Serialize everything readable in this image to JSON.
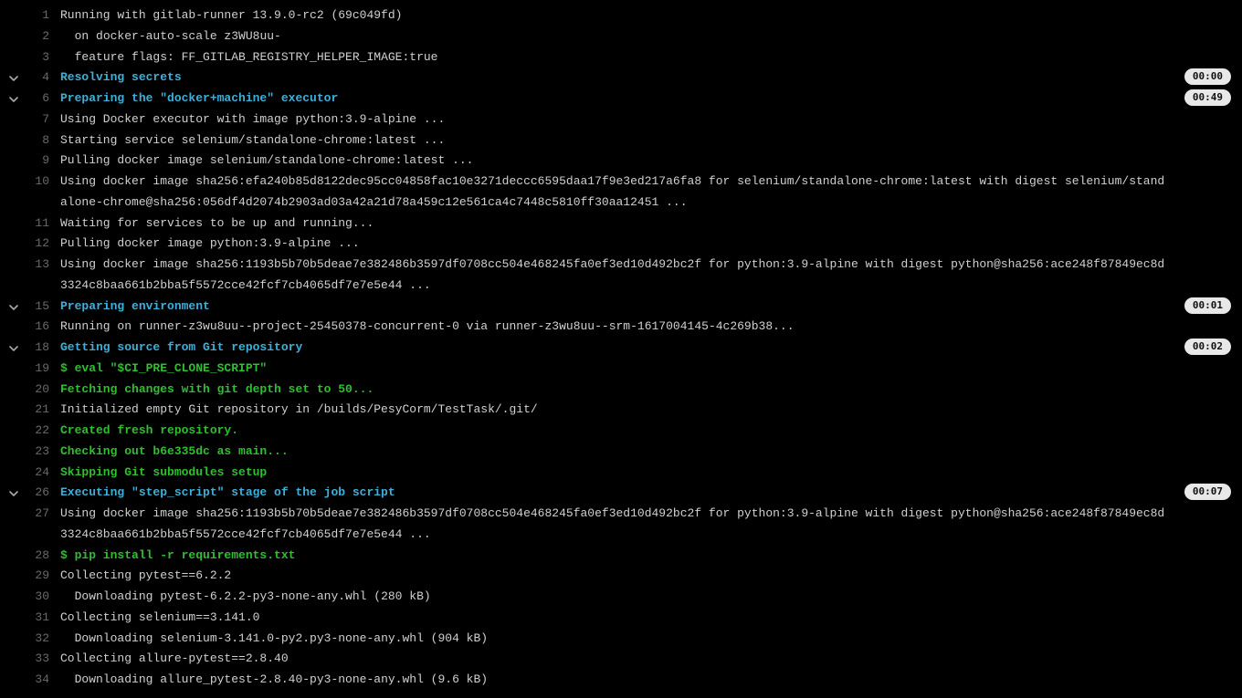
{
  "lines": [
    {
      "n": 1,
      "cls": "c-default",
      "collapsible": false,
      "badge": null,
      "text": "Running with gitlab-runner 13.9.0-rc2 (69c049fd)"
    },
    {
      "n": 2,
      "cls": "c-default",
      "collapsible": false,
      "badge": null,
      "text": "  on docker-auto-scale z3WU8uu-"
    },
    {
      "n": 3,
      "cls": "c-default",
      "collapsible": false,
      "badge": null,
      "text": "  feature flags: FF_GITLAB_REGISTRY_HELPER_IMAGE:true"
    },
    {
      "n": 4,
      "cls": "c-section",
      "collapsible": true,
      "badge": "00:00",
      "text": "Resolving secrets"
    },
    {
      "n": 6,
      "cls": "c-section",
      "collapsible": true,
      "badge": "00:49",
      "text": "Preparing the \"docker+machine\" executor"
    },
    {
      "n": 7,
      "cls": "c-default",
      "collapsible": false,
      "badge": null,
      "text": "Using Docker executor with image python:3.9-alpine ..."
    },
    {
      "n": 8,
      "cls": "c-default",
      "collapsible": false,
      "badge": null,
      "text": "Starting service selenium/standalone-chrome:latest ..."
    },
    {
      "n": 9,
      "cls": "c-default",
      "collapsible": false,
      "badge": null,
      "text": "Pulling docker image selenium/standalone-chrome:latest ..."
    },
    {
      "n": 10,
      "cls": "c-default",
      "collapsible": false,
      "badge": null,
      "text": "Using docker image sha256:efa240b85d8122dec95cc04858fac10e3271deccc6595daa17f9e3ed217a6fa8 for selenium/standalone-chrome:latest with digest selenium/standalone-chrome@sha256:056df4d2074b2903ad03a42a21d78a459c12e561ca4c7448c5810ff30aa12451 ..."
    },
    {
      "n": 11,
      "cls": "c-default",
      "collapsible": false,
      "badge": null,
      "text": "Waiting for services to be up and running..."
    },
    {
      "n": 12,
      "cls": "c-default",
      "collapsible": false,
      "badge": null,
      "text": "Pulling docker image python:3.9-alpine ..."
    },
    {
      "n": 13,
      "cls": "c-default",
      "collapsible": false,
      "badge": null,
      "text": "Using docker image sha256:1193b5b70b5deae7e382486b3597df0708cc504e468245fa0ef3ed10d492bc2f for python:3.9-alpine with digest python@sha256:ace248f87849ec8d3324c8baa661b2bba5f5572cce42fcf7cb4065df7e7e5e44 ..."
    },
    {
      "n": 15,
      "cls": "c-section",
      "collapsible": true,
      "badge": "00:01",
      "text": "Preparing environment"
    },
    {
      "n": 16,
      "cls": "c-default",
      "collapsible": false,
      "badge": null,
      "text": "Running on runner-z3wu8uu--project-25450378-concurrent-0 via runner-z3wu8uu--srm-1617004145-4c269b38..."
    },
    {
      "n": 18,
      "cls": "c-section",
      "collapsible": true,
      "badge": "00:02",
      "text": "Getting source from Git repository"
    },
    {
      "n": 19,
      "cls": "c-green",
      "collapsible": false,
      "badge": null,
      "text": "$ eval \"$CI_PRE_CLONE_SCRIPT\""
    },
    {
      "n": 20,
      "cls": "c-green",
      "collapsible": false,
      "badge": null,
      "text": "Fetching changes with git depth set to 50..."
    },
    {
      "n": 21,
      "cls": "c-default",
      "collapsible": false,
      "badge": null,
      "text": "Initialized empty Git repository in /builds/PesyCorm/TestTask/.git/"
    },
    {
      "n": 22,
      "cls": "c-green",
      "collapsible": false,
      "badge": null,
      "text": "Created fresh repository."
    },
    {
      "n": 23,
      "cls": "c-green",
      "collapsible": false,
      "badge": null,
      "text": "Checking out b6e335dc as main..."
    },
    {
      "n": 24,
      "cls": "c-green",
      "collapsible": false,
      "badge": null,
      "text": "Skipping Git submodules setup"
    },
    {
      "n": 26,
      "cls": "c-section",
      "collapsible": true,
      "badge": "00:07",
      "text": "Executing \"step_script\" stage of the job script"
    },
    {
      "n": 27,
      "cls": "c-default",
      "collapsible": false,
      "badge": null,
      "text": "Using docker image sha256:1193b5b70b5deae7e382486b3597df0708cc504e468245fa0ef3ed10d492bc2f for python:3.9-alpine with digest python@sha256:ace248f87849ec8d3324c8baa661b2bba5f5572cce42fcf7cb4065df7e7e5e44 ..."
    },
    {
      "n": 28,
      "cls": "c-green",
      "collapsible": false,
      "badge": null,
      "text": "$ pip install -r requirements.txt"
    },
    {
      "n": 29,
      "cls": "c-default",
      "collapsible": false,
      "badge": null,
      "text": "Collecting pytest==6.2.2"
    },
    {
      "n": 30,
      "cls": "c-default",
      "collapsible": false,
      "badge": null,
      "text": "  Downloading pytest-6.2.2-py3-none-any.whl (280 kB)"
    },
    {
      "n": 31,
      "cls": "c-default",
      "collapsible": false,
      "badge": null,
      "text": "Collecting selenium==3.141.0"
    },
    {
      "n": 32,
      "cls": "c-default",
      "collapsible": false,
      "badge": null,
      "text": "  Downloading selenium-3.141.0-py2.py3-none-any.whl (904 kB)"
    },
    {
      "n": 33,
      "cls": "c-default",
      "collapsible": false,
      "badge": null,
      "text": "Collecting allure-pytest==2.8.40"
    },
    {
      "n": 34,
      "cls": "c-default",
      "collapsible": false,
      "badge": null,
      "text": "  Downloading allure_pytest-2.8.40-py3-none-any.whl (9.6 kB)"
    }
  ]
}
